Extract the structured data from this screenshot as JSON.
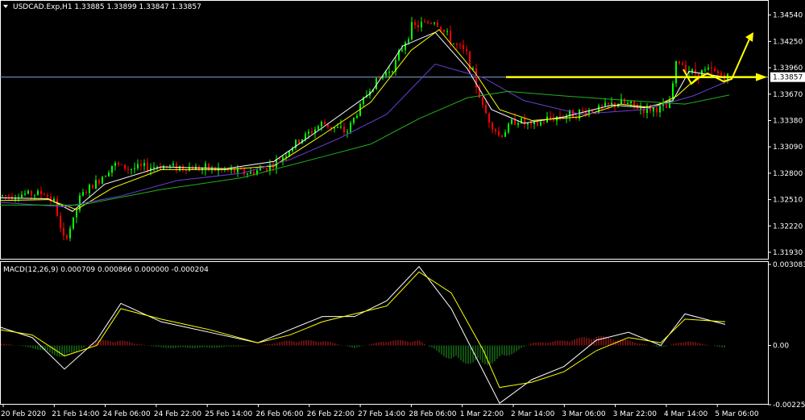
{
  "colors": {
    "background": "#000000",
    "axis": "#ffffff",
    "bull": "#00ff00",
    "bear": "#ff0000",
    "ma_fast": "#ffffff",
    "ma_mid": "#ffff00",
    "ma_slow": "#6a3fd6",
    "ma_long": "#20b020",
    "level_line": "#7ea4d6",
    "annotation": "#ffff00",
    "macd_pos": "#d02020",
    "macd_neg": "#20a020",
    "signal": "#ffff00",
    "macd_line": "#ffffff"
  },
  "header": {
    "symbol_title": "USDCAD.Exp,H1  1.33885 1.33899 1.33847 1.33857"
  },
  "chart_data": [
    {
      "type": "candlestick",
      "title": "USDCAD.Exp,H1  1.33885 1.33899 1.33847 1.33857",
      "ylim": [
        1.3185,
        1.3467
      ],
      "y_ticks": [
        "1.34540",
        "1.34250",
        "1.33960",
        "1.33670",
        "1.33380",
        "1.33090",
        "1.32800",
        "1.32510",
        "1.32220",
        "1.31930"
      ],
      "current_price": "1.33857",
      "x_ticks": [
        "20 Feb 2020",
        "21 Feb 14:00",
        "24 Feb 06:00",
        "24 Feb 22:00",
        "25 Feb 14:00",
        "26 Feb 06:00",
        "26 Feb 22:00",
        "27 Feb 14:00",
        "28 Feb 06:00",
        "1 Mar 22:00",
        "2 Mar 14:00",
        "3 Mar 06:00",
        "3 Mar 22:00",
        "4 Mar 14:00",
        "5 Mar 06:00"
      ],
      "price_path": [
        [
          0,
          1.3255
        ],
        [
          30,
          1.3257
        ],
        [
          55,
          1.3258
        ],
        [
          68,
          1.3248
        ],
        [
          78,
          1.3205
        ],
        [
          90,
          1.3225
        ],
        [
          100,
          1.3255
        ],
        [
          120,
          1.327
        ],
        [
          140,
          1.329
        ],
        [
          160,
          1.3285
        ],
        [
          200,
          1.3288
        ],
        [
          240,
          1.3286
        ],
        [
          280,
          1.3283
        ],
        [
          310,
          1.328
        ],
        [
          340,
          1.329
        ],
        [
          370,
          1.3315
        ],
        [
          400,
          1.3335
        ],
        [
          430,
          1.3325
        ],
        [
          460,
          1.3375
        ],
        [
          490,
          1.34
        ],
        [
          510,
          1.344
        ],
        [
          540,
          1.3448
        ],
        [
          560,
          1.3425
        ],
        [
          580,
          1.341
        ],
        [
          600,
          1.335
        ],
        [
          620,
          1.332
        ],
        [
          640,
          1.334
        ],
        [
          660,
          1.333
        ],
        [
          680,
          1.334
        ],
        [
          710,
          1.3345
        ],
        [
          740,
          1.335
        ],
        [
          770,
          1.3358
        ],
        [
          800,
          1.335
        ],
        [
          830,
          1.3352
        ],
        [
          840,
          1.3405
        ],
        [
          860,
          1.339
        ],
        [
          880,
          1.3393
        ],
        [
          905,
          1.3385
        ]
      ],
      "moving_averages": [
        {
          "path": [
            [
              0,
              1.3253
            ],
            [
              60,
              1.3252
            ],
            [
              90,
              1.3238
            ],
            [
              130,
              1.3268
            ],
            [
              200,
              1.3287
            ],
            [
              280,
              1.3285
            ],
            [
              340,
              1.3293
            ],
            [
              400,
              1.333
            ],
            [
              460,
              1.3368
            ],
            [
              500,
              1.342
            ],
            [
              540,
              1.3435
            ],
            [
              580,
              1.3395
            ],
            [
              610,
              1.335
            ],
            [
              650,
              1.3335
            ],
            [
              700,
              1.3342
            ],
            [
              760,
              1.3355
            ],
            [
              800,
              1.3352
            ],
            [
              835,
              1.336
            ],
            [
              855,
              1.3392
            ],
            [
              905,
              1.3385
            ]
          ]
        },
        {
          "path": [
            [
              0,
              1.325
            ],
            [
              60,
              1.3251
            ],
            [
              95,
              1.324
            ],
            [
              140,
              1.3264
            ],
            [
              200,
              1.3284
            ],
            [
              280,
              1.3284
            ],
            [
              340,
              1.3288
            ],
            [
              400,
              1.3322
            ],
            [
              460,
              1.3358
            ],
            [
              510,
              1.3415
            ],
            [
              545,
              1.3438
            ],
            [
              590,
              1.339
            ],
            [
              620,
              1.335
            ],
            [
              660,
              1.3338
            ],
            [
              720,
              1.3342
            ],
            [
              770,
              1.3356
            ],
            [
              810,
              1.3352
            ],
            [
              840,
              1.3365
            ],
            [
              865,
              1.3385
            ],
            [
              905,
              1.3386
            ]
          ]
        },
        {
          "path": [
            [
              0,
              1.3248
            ],
            [
              80,
              1.3243
            ],
            [
              150,
              1.3255
            ],
            [
              220,
              1.3272
            ],
            [
              300,
              1.328
            ],
            [
              360,
              1.3295
            ],
            [
              420,
              1.3318
            ],
            [
              480,
              1.3345
            ],
            [
              540,
              1.34
            ],
            [
              600,
              1.3385
            ],
            [
              650,
              1.336
            ],
            [
              720,
              1.3345
            ],
            [
              800,
              1.335
            ],
            [
              860,
              1.3365
            ],
            [
              905,
              1.3382
            ]
          ]
        },
        {
          "path": [
            [
              0,
              1.3245
            ],
            [
              100,
              1.3245
            ],
            [
              200,
              1.3262
            ],
            [
              300,
              1.3275
            ],
            [
              400,
              1.3298
            ],
            [
              460,
              1.3312
            ],
            [
              520,
              1.334
            ],
            [
              580,
              1.3363
            ],
            [
              630,
              1.337
            ],
            [
              700,
              1.3365
            ],
            [
              780,
              1.336
            ],
            [
              850,
              1.3356
            ],
            [
              905,
              1.3366
            ]
          ]
        }
      ],
      "annotation": "arrows"
    },
    {
      "type": "line",
      "title": "MACD(12,26,9) 0.000709 0.000866 0.000000 -0.000204",
      "ylim": [
        -0.002255,
        0.003083
      ],
      "y_ticks": [
        "0.003083",
        "0.00",
        "-0.002255"
      ],
      "x": [
        0,
        40,
        80,
        120,
        150,
        200,
        260,
        320,
        360,
        400,
        440,
        480,
        520,
        560,
        600,
        620,
        660,
        700,
        740,
        780,
        820,
        850,
        900
      ],
      "series": [
        {
          "values": [
            0.0007,
            0.0003,
            -0.0009,
            0.0002,
            0.0016,
            0.0009,
            0.0005,
            0.0001,
            0.0006,
            0.0011,
            0.0011,
            0.0017,
            0.003,
            0.0014,
            -0.001,
            -0.0022,
            -0.0013,
            -0.0008,
            0.0002,
            0.0005,
            0.0,
            0.0012,
            0.0008
          ]
        },
        {
          "values": [
            0.0006,
            0.0004,
            -0.0004,
            0.0,
            0.0014,
            0.001,
            0.0006,
            0.0001,
            0.0004,
            0.0009,
            0.0012,
            0.0015,
            0.0028,
            0.002,
            -0.0002,
            -0.0016,
            -0.0014,
            -0.001,
            -0.0002,
            0.0003,
            0.0001,
            0.001,
            0.0009
          ]
        }
      ],
      "histogram": [
        0.0001,
        -0.0001,
        -0.0005,
        0.0002,
        0.0002,
        -0.0001,
        -0.0001,
        0.0,
        0.0002,
        0.0002,
        -0.0001,
        0.0002,
        0.0002,
        -0.0006,
        -0.0008,
        -0.0006,
        0.0001,
        0.0002,
        0.0004,
        0.0002,
        -0.0001,
        0.0002,
        -0.0001
      ]
    }
  ]
}
